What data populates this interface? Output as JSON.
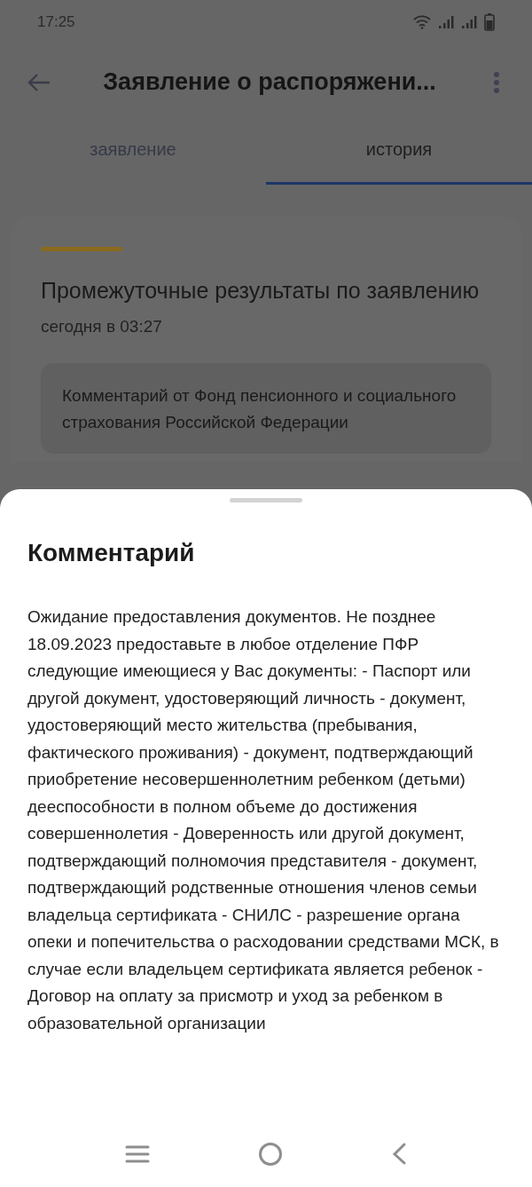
{
  "status_bar": {
    "time": "17:25"
  },
  "app_bar": {
    "title": "Заявление о распоряжени..."
  },
  "tabs": [
    {
      "label": "заявление",
      "selected": false
    },
    {
      "label": "история",
      "selected": true
    }
  ],
  "card": {
    "title": "Промежуточные результаты по заявлению",
    "date": "сегодня в 03:27",
    "comment_heading": "Комментарий от Фонд пенсионного и социального страхования Российской Федерации"
  },
  "sheet": {
    "title": "Комментарий",
    "text": "Ожидание предоставления документов. Не позднее 18.09.2023 предоставьте в любое отделение ПФР следующие имеющиеся у Вас документы: - Паспорт или другой документ, удостоверяющий личность - документ, удостоверяющий место жительства (пребывания, фактического проживания) - документ, подтверждающий приобретение несовершеннолетним ребенком (детьми) дееспособности в полном объеме до достижения совершеннолетия - Доверенность или другой документ, подтверждающий полномочия представителя - документ, подтверждающий родственные отношения членов семьи владельца сертификата - СНИЛС - разрешение органа опеки и попечительства о расходовании средствами МСК, в случае если владельцем сертификата является ребенок - Договор на оплату за присмотр и уход за ребенком в образовательной организации"
  }
}
